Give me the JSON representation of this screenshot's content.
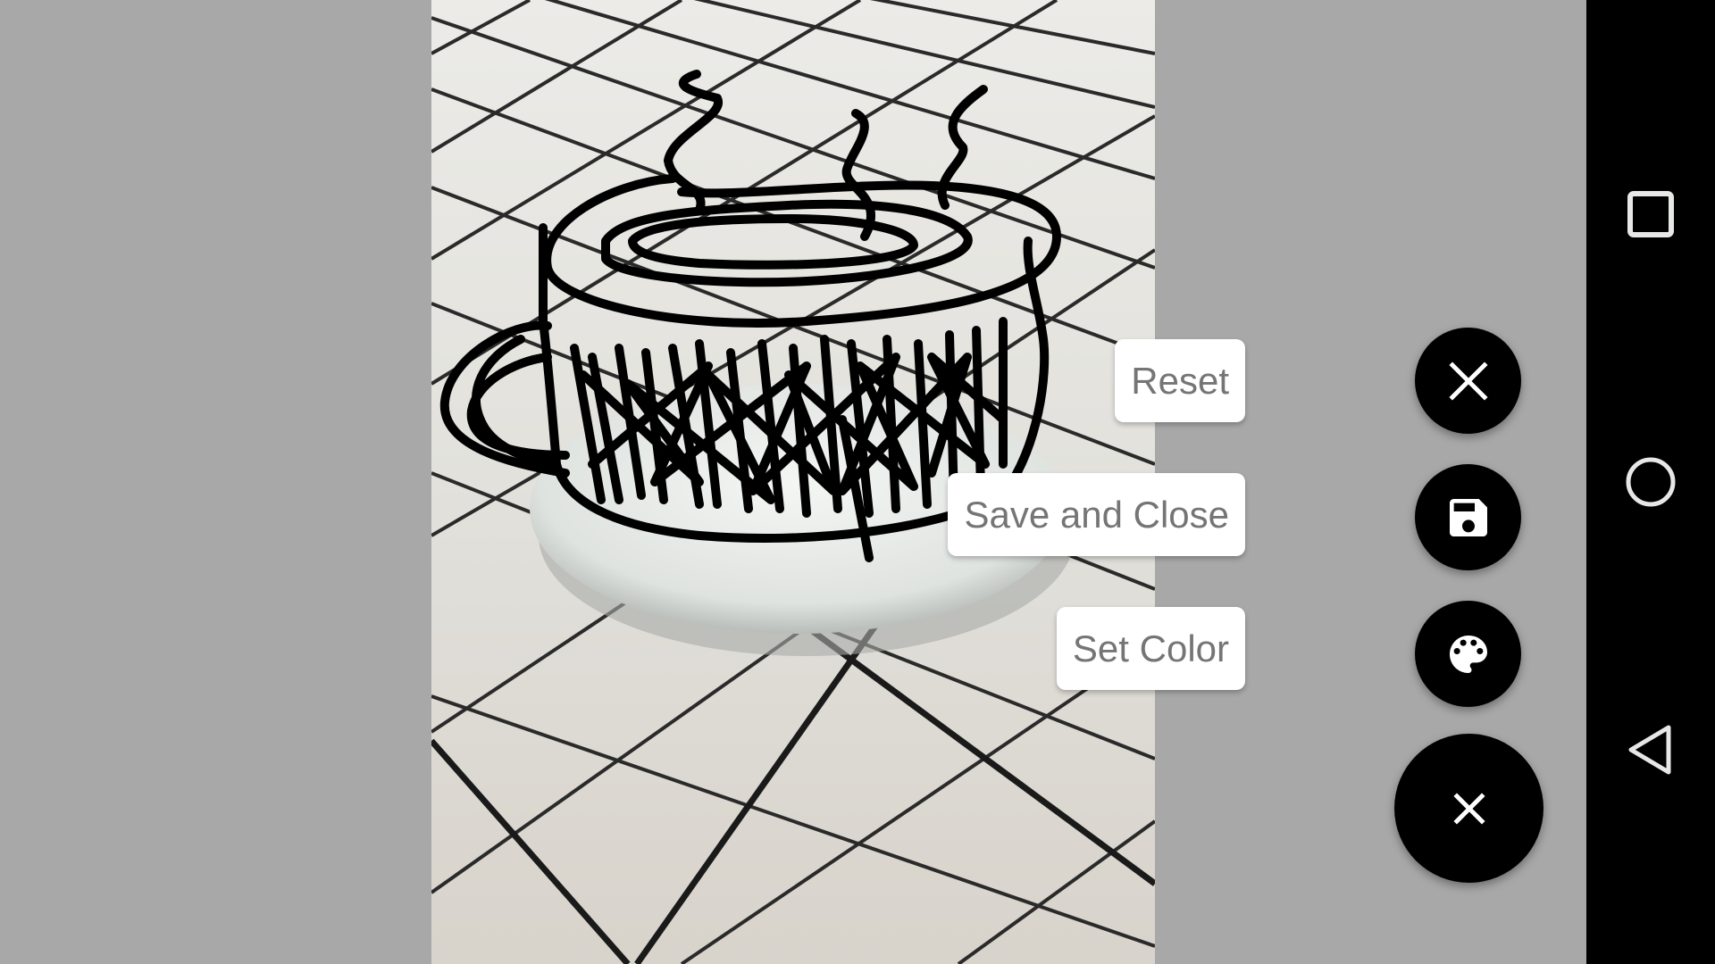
{
  "drawing_app": {
    "photo_description": "Photo of white ceramic tiles with black grout and a white saucer, overlaid with a black hand-drawn steaming coffee cup sketch",
    "stroke_color": "#000000"
  },
  "speed_dial": {
    "actions": [
      {
        "id": "reset",
        "label": "Reset",
        "icon": "close-icon"
      },
      {
        "id": "save",
        "label": "Save and Close",
        "icon": "save-icon"
      },
      {
        "id": "color",
        "label": "Set Color",
        "icon": "palette-icon"
      }
    ],
    "main_fab_icon": "close-icon",
    "fab_color": "#000000"
  },
  "nav_bar": {
    "buttons": [
      {
        "id": "recents",
        "icon": "square-icon"
      },
      {
        "id": "home",
        "icon": "circle-icon"
      },
      {
        "id": "back",
        "icon": "triangle-back-icon"
      }
    ]
  }
}
